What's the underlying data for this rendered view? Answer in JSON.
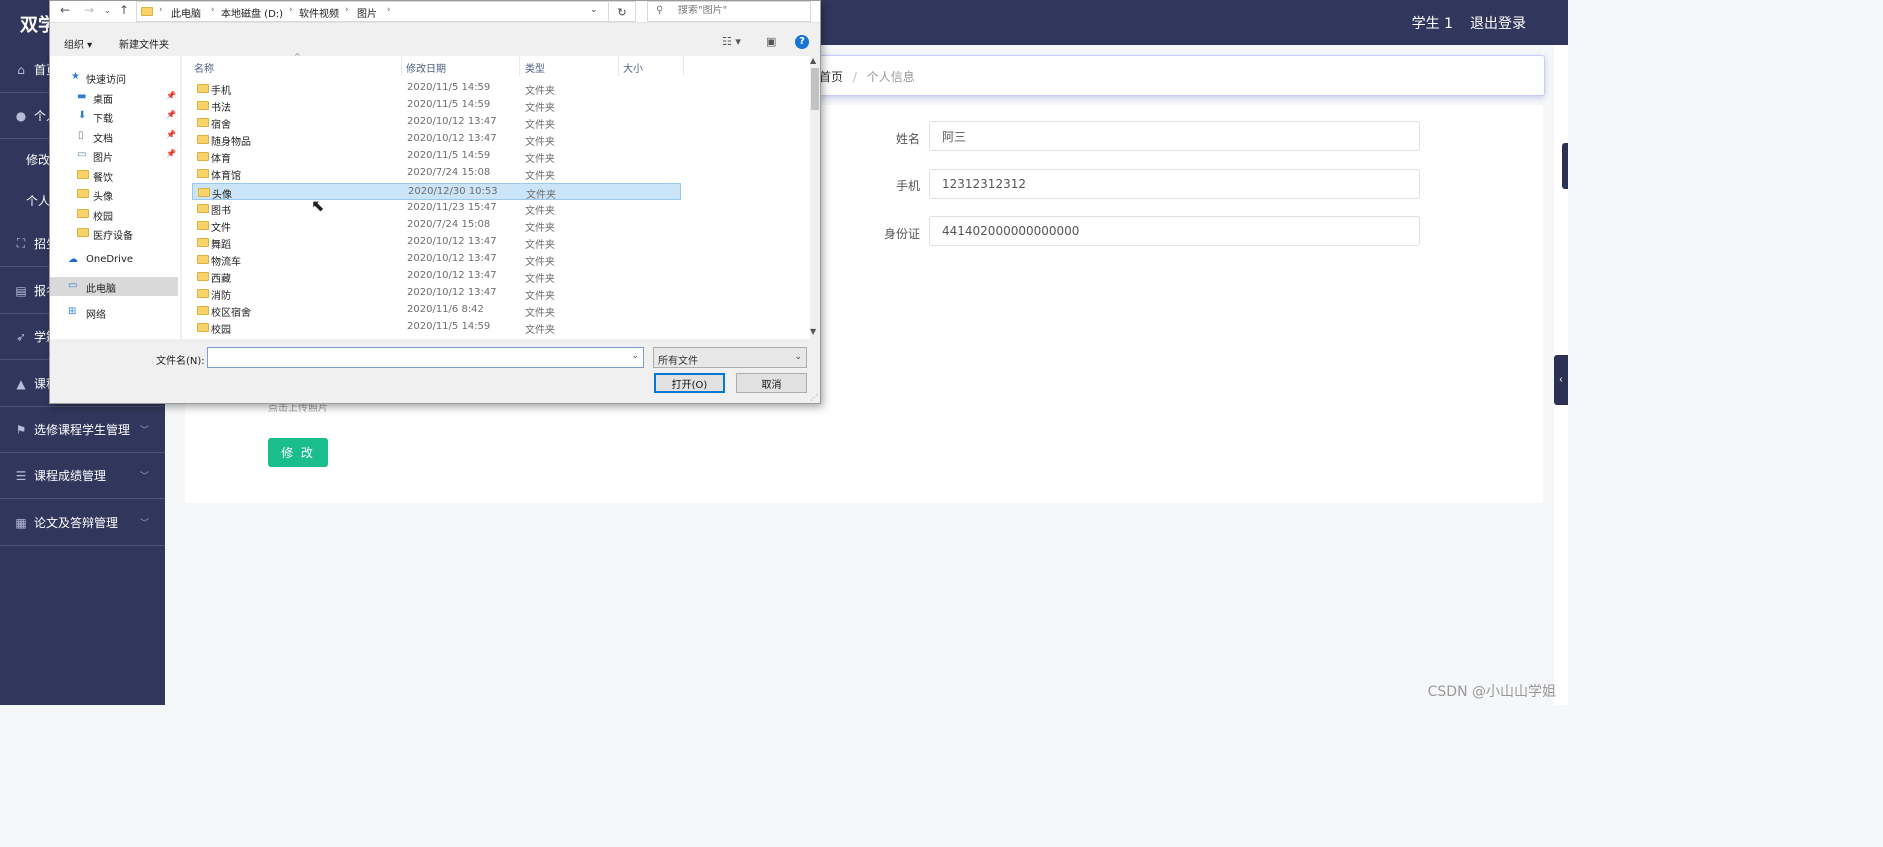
{
  "app": {
    "title": "双学",
    "user": "学生 1",
    "logout": "退出登录",
    "watermark": "CSDN @小山山学姐"
  },
  "sidebar": {
    "items": [
      {
        "label": "首页",
        "icon": "home-icon"
      },
      {
        "label": "个人",
        "icon": "user-icon"
      },
      {
        "label": "招生",
        "icon": "scan-icon"
      },
      {
        "label": "报名",
        "icon": "clipboard-icon"
      },
      {
        "label": "学籍",
        "icon": "send-icon"
      },
      {
        "label": "课程",
        "icon": "thumbs-up-icon"
      },
      {
        "label": "选修课程学生管理",
        "icon": "flag-icon"
      },
      {
        "label": "课程成绩管理",
        "icon": "list-icon"
      },
      {
        "label": "论文及答辩管理",
        "icon": "grid-icon"
      }
    ],
    "subitems": [
      {
        "label": "修改"
      },
      {
        "label": "个人"
      }
    ]
  },
  "breadcrumb": {
    "home": "首页",
    "separator": "/",
    "current": "个人信息"
  },
  "form": {
    "name_label": "姓名",
    "name_value": "阿三",
    "phone_label": "手机",
    "phone_value": "12312312312",
    "idcard_label": "身份证",
    "idcard_value": "441402000000000000",
    "upload_hint": "点击上传照片",
    "submit_label": "修 改"
  },
  "dialog": {
    "path": [
      "此电脑",
      "本地磁盘 (D:)",
      "软件视频",
      "图片"
    ],
    "search_placeholder": "搜索\"图片\"",
    "toolbar": {
      "organize": "组织 ▾",
      "new_folder": "新建文件夹"
    },
    "nav": [
      {
        "label": "快速访问",
        "icon": "star-icon",
        "pinned": false,
        "indent": 1
      },
      {
        "label": "桌面",
        "icon": "desktop-icon",
        "pinned": true,
        "indent": 2
      },
      {
        "label": "下载",
        "icon": "download-icon",
        "pinned": true,
        "indent": 2
      },
      {
        "label": "文档",
        "icon": "document-icon",
        "pinned": true,
        "indent": 2
      },
      {
        "label": "图片",
        "icon": "pictures-icon",
        "pinned": true,
        "indent": 2
      },
      {
        "label": "餐饮",
        "icon": "folder-icon",
        "pinned": false,
        "indent": 2
      },
      {
        "label": "头像",
        "icon": "folder-icon",
        "pinned": false,
        "indent": 2
      },
      {
        "label": "校园",
        "icon": "folder-icon",
        "pinned": false,
        "indent": 2
      },
      {
        "label": "医疗设备",
        "icon": "folder-icon",
        "pinned": false,
        "indent": 2
      },
      {
        "label": "OneDrive",
        "icon": "cloud-icon",
        "pinned": false,
        "indent": 1
      },
      {
        "label": "此电脑",
        "icon": "computer-icon",
        "pinned": false,
        "indent": 1,
        "selected": true
      },
      {
        "label": "网络",
        "icon": "network-icon",
        "pinned": false,
        "indent": 1
      }
    ],
    "columns": [
      "名称",
      "修改日期",
      "类型",
      "大小"
    ],
    "files": [
      {
        "name": "手机",
        "date": "2020/11/5 14:59",
        "type": "文件夹"
      },
      {
        "name": "书法",
        "date": "2020/11/5 14:59",
        "type": "文件夹"
      },
      {
        "name": "宿舍",
        "date": "2020/10/12 13:47",
        "type": "文件夹"
      },
      {
        "name": "随身物品",
        "date": "2020/10/12 13:47",
        "type": "文件夹"
      },
      {
        "name": "体育",
        "date": "2020/11/5 14:59",
        "type": "文件夹"
      },
      {
        "name": "体育馆",
        "date": "2020/7/24 15:08",
        "type": "文件夹"
      },
      {
        "name": "头像",
        "date": "2020/12/30 10:53",
        "type": "文件夹",
        "selected": true
      },
      {
        "name": "图书",
        "date": "2020/11/23 15:47",
        "type": "文件夹"
      },
      {
        "name": "文件",
        "date": "2020/7/24 15:08",
        "type": "文件夹"
      },
      {
        "name": "舞蹈",
        "date": "2020/10/12 13:47",
        "type": "文件夹"
      },
      {
        "name": "物流车",
        "date": "2020/10/12 13:47",
        "type": "文件夹"
      },
      {
        "name": "西藏",
        "date": "2020/10/12 13:47",
        "type": "文件夹"
      },
      {
        "name": "消防",
        "date": "2020/10/12 13:47",
        "type": "文件夹"
      },
      {
        "name": "校区宿舍",
        "date": "2020/11/6 8:42",
        "type": "文件夹"
      },
      {
        "name": "校园",
        "date": "2020/11/5 14:59",
        "type": "文件夹"
      }
    ],
    "filename_label": "文件名(N):",
    "filename_value": "",
    "filter": "所有文件",
    "open_label": "打开(O)",
    "cancel_label": "取消"
  },
  "colors": {
    "sidebar_bg": "#31375c",
    "accent_green": "#19be8c",
    "selection_blue": "#cce4f7",
    "dialog_bg": "#f0f0f0"
  }
}
